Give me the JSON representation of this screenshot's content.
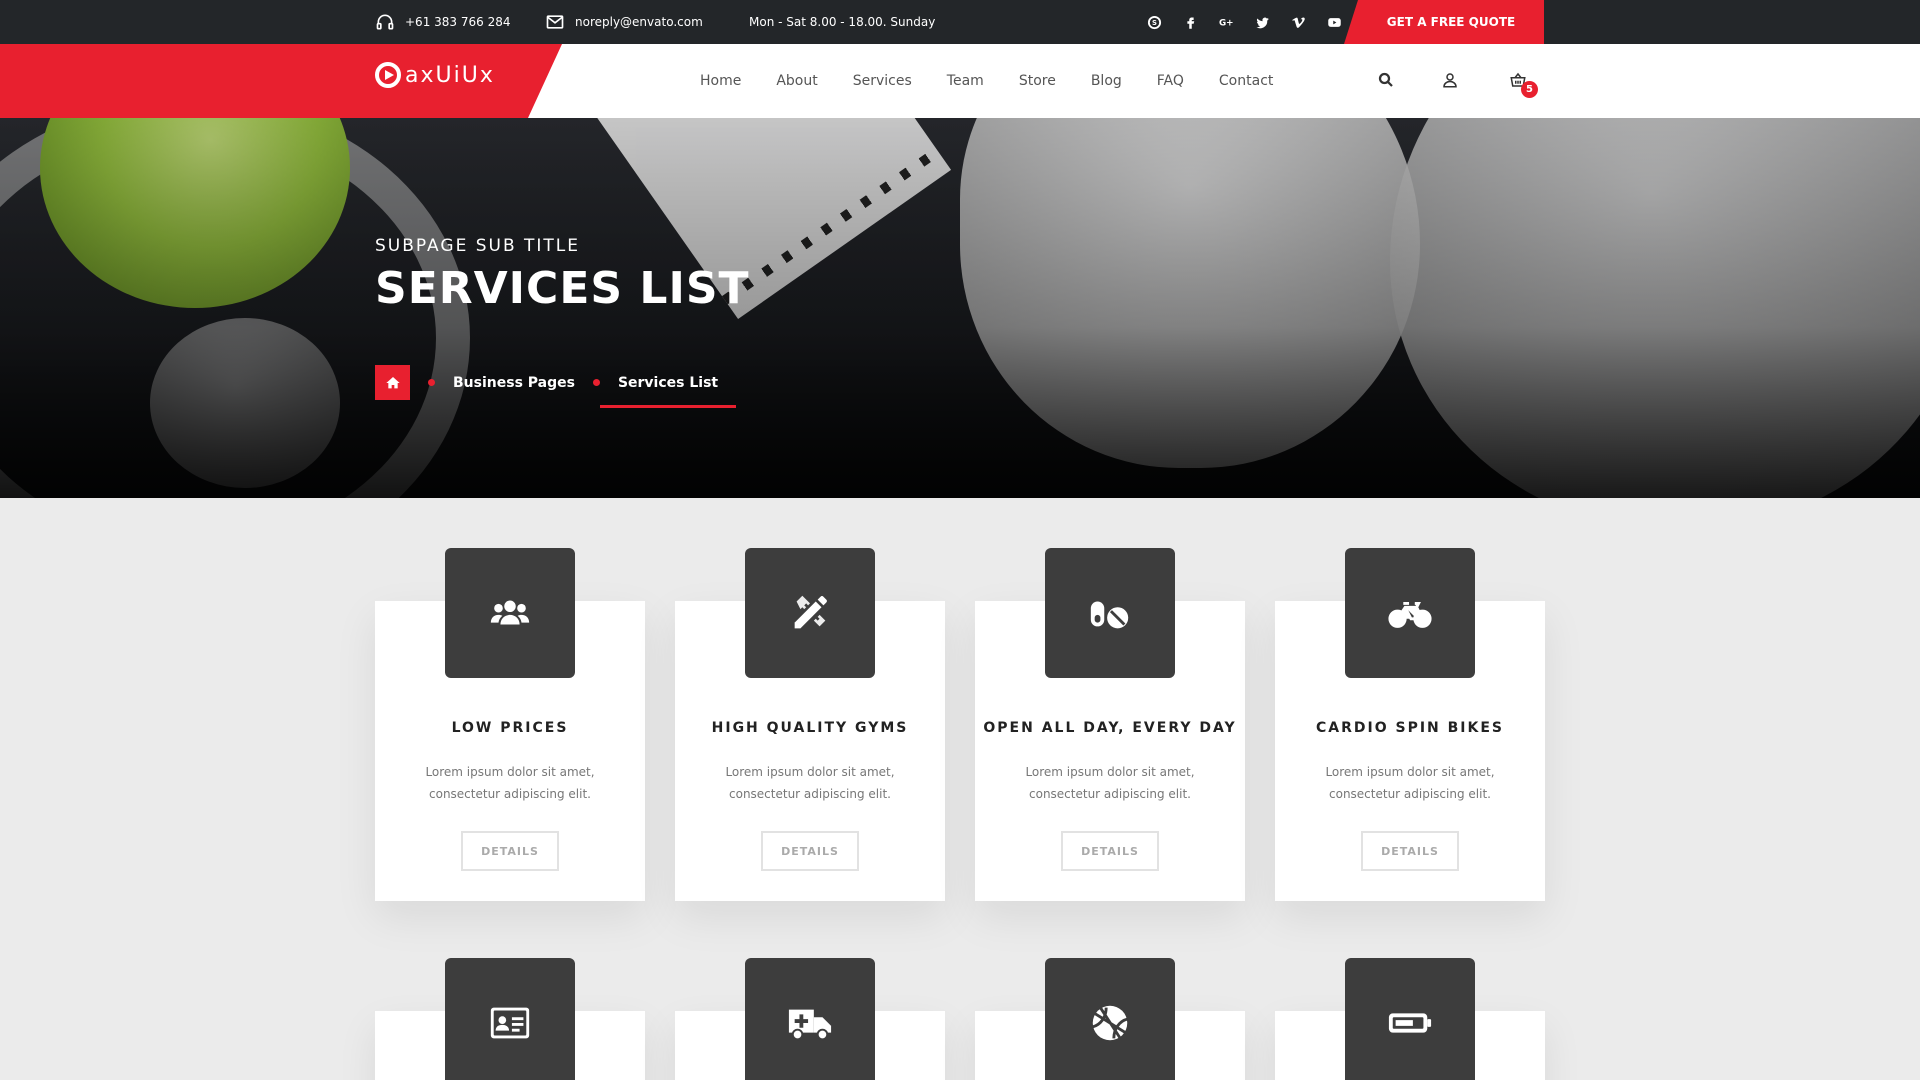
{
  "topbar": {
    "phone": "+61 383 766 284",
    "email": "noreply@envato.com",
    "hours": "Mon - Sat 8.00 - 18.00. Sunday",
    "social": [
      "skype-icon",
      "facebook-icon",
      "google-plus-icon",
      "twitter-icon",
      "vimeo-icon",
      "youtube-icon"
    ],
    "quote_label": "GET A FREE QUOTE"
  },
  "brand": {
    "logo_text": "axUiUx",
    "accent": "#e8202f"
  },
  "nav": {
    "items": [
      "Home",
      "About",
      "Services",
      "Team",
      "Store",
      "Blog",
      "FAQ",
      "Contact"
    ],
    "cart_count": "5"
  },
  "hero": {
    "subtitle": "SUBPAGE SUB TITLE",
    "title": "SERVICES LIST",
    "breadcrumb": {
      "parent": "Business Pages",
      "current": "Services List"
    }
  },
  "services": [
    {
      "icon": "users-icon",
      "title": "LOW PRICES",
      "text": "Lorem ipsum dolor sit amet, consectetur adipiscing elit.",
      "button": "DETAILS"
    },
    {
      "icon": "pencil-ruler-icon",
      "title": "HIGH QUALITY GYMS",
      "text": "Lorem ipsum dolor sit amet, consectetur adipiscing elit.",
      "button": "DETAILS"
    },
    {
      "icon": "pills-icon",
      "title": "OPEN ALL DAY, EVERY DAY",
      "text": "Lorem ipsum dolor sit amet, consectetur adipiscing elit.",
      "button": "DETAILS"
    },
    {
      "icon": "bicycle-icon",
      "title": "CARDIO SPIN BIKES",
      "text": "Lorem ipsum dolor sit amet, consectetur adipiscing elit.",
      "button": "DETAILS"
    },
    {
      "icon": "id-card-icon"
    },
    {
      "icon": "ambulance-icon"
    },
    {
      "icon": "basketball-icon"
    },
    {
      "icon": "battery-icon"
    }
  ]
}
